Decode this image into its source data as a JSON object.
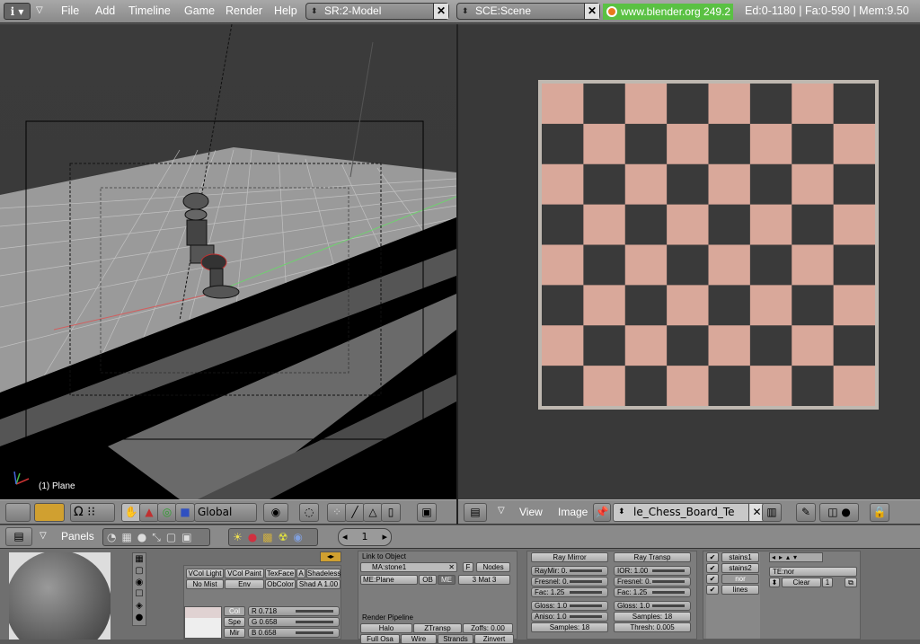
{
  "menubar": {
    "items": [
      "File",
      "Add",
      "Timeline",
      "Game",
      "Render",
      "Help"
    ],
    "screen_field": "SR:2-Model",
    "scene_field": "SCE:Scene",
    "website": "www.blender.org 249.2",
    "stats": "Ed:0-1180 | Fa:0-590 | Mem:9.50"
  },
  "view3d": {
    "object_label": "(1) Plane",
    "orientation": "Global"
  },
  "image_editor": {
    "menu": [
      "View",
      "Image"
    ],
    "image_name": "le_Chess_Board_Te",
    "checker": {
      "dark": "#3a3a3a",
      "light": "#d9a89a"
    }
  },
  "buttons_header": {
    "panels_label": "Panels",
    "frame": "1"
  },
  "shader": {
    "row1": [
      "VCol Light",
      "VCol Paint",
      "TexFace",
      "A",
      "Shadeless"
    ],
    "row2": [
      "No Mist",
      "Env",
      "ObColor",
      "Shad A 1.00"
    ],
    "col_tabs": [
      "Col",
      "Spe",
      "Mir"
    ],
    "rgb": [
      "R 0.718",
      "G 0.658",
      "B 0.658"
    ]
  },
  "link": {
    "title": "Link to Object",
    "material": "MA:stone1",
    "f_btn": "F",
    "nodes": "Nodes",
    "me": "ME:Plane",
    "ob": "OB",
    "me_btn": "ME",
    "mat": "3 Mat 3",
    "pipeline_title": "Render Pipeline",
    "pipe1": [
      "Halo",
      "ZTransp",
      "Zoffs: 0.00"
    ],
    "pipe2": [
      "Full Osa",
      "Wire",
      "Strands",
      "Zinvert"
    ]
  },
  "mirror": {
    "ray_mirror": "Ray Mirror",
    "ray_transp": "Ray Transp",
    "left": [
      "RayMir: 0.",
      "Fresnel: 0.",
      "Fac: 1.25"
    ],
    "right": [
      "IOR: 1.00",
      "Fresnel: 0.",
      "Fac: 1.25"
    ],
    "gloss_left": [
      "Gloss: 1.0",
      "Aniso: 1.0",
      "Samples: 18"
    ],
    "gloss_right": [
      "Gloss: 1.0",
      "Samples: 18",
      "Thresh: 0.005"
    ]
  },
  "textures": {
    "slots": [
      "stains1",
      "stains2",
      "nor",
      "lines"
    ],
    "te": "TE:nor",
    "clear": "Clear",
    "count": "1"
  }
}
